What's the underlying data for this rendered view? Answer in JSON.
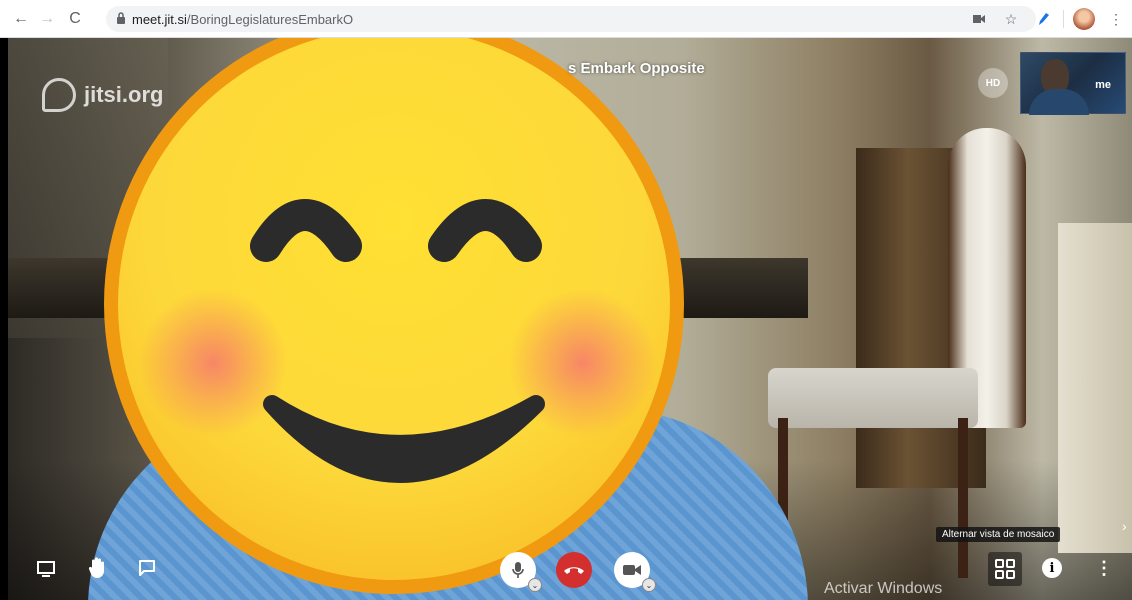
{
  "browser": {
    "url_host": "meet.jit.si",
    "url_path": "/BoringLegislaturesEmbarkO",
    "back_icon": "←",
    "forward_icon": "→",
    "reload_icon": "C"
  },
  "meeting": {
    "logo_text": "jitsi.org",
    "title": "s Embark Opposite",
    "quality_badge": "HD",
    "self_view_label": "me"
  },
  "toolbar": {
    "tooltip": "Alternar vista de mosaico"
  },
  "os_watermark": "Activar Windows",
  "colors": {
    "hangup": "#d32f2f",
    "emoji_face": "#fdd83a",
    "emoji_rim": "#ef9a10"
  }
}
